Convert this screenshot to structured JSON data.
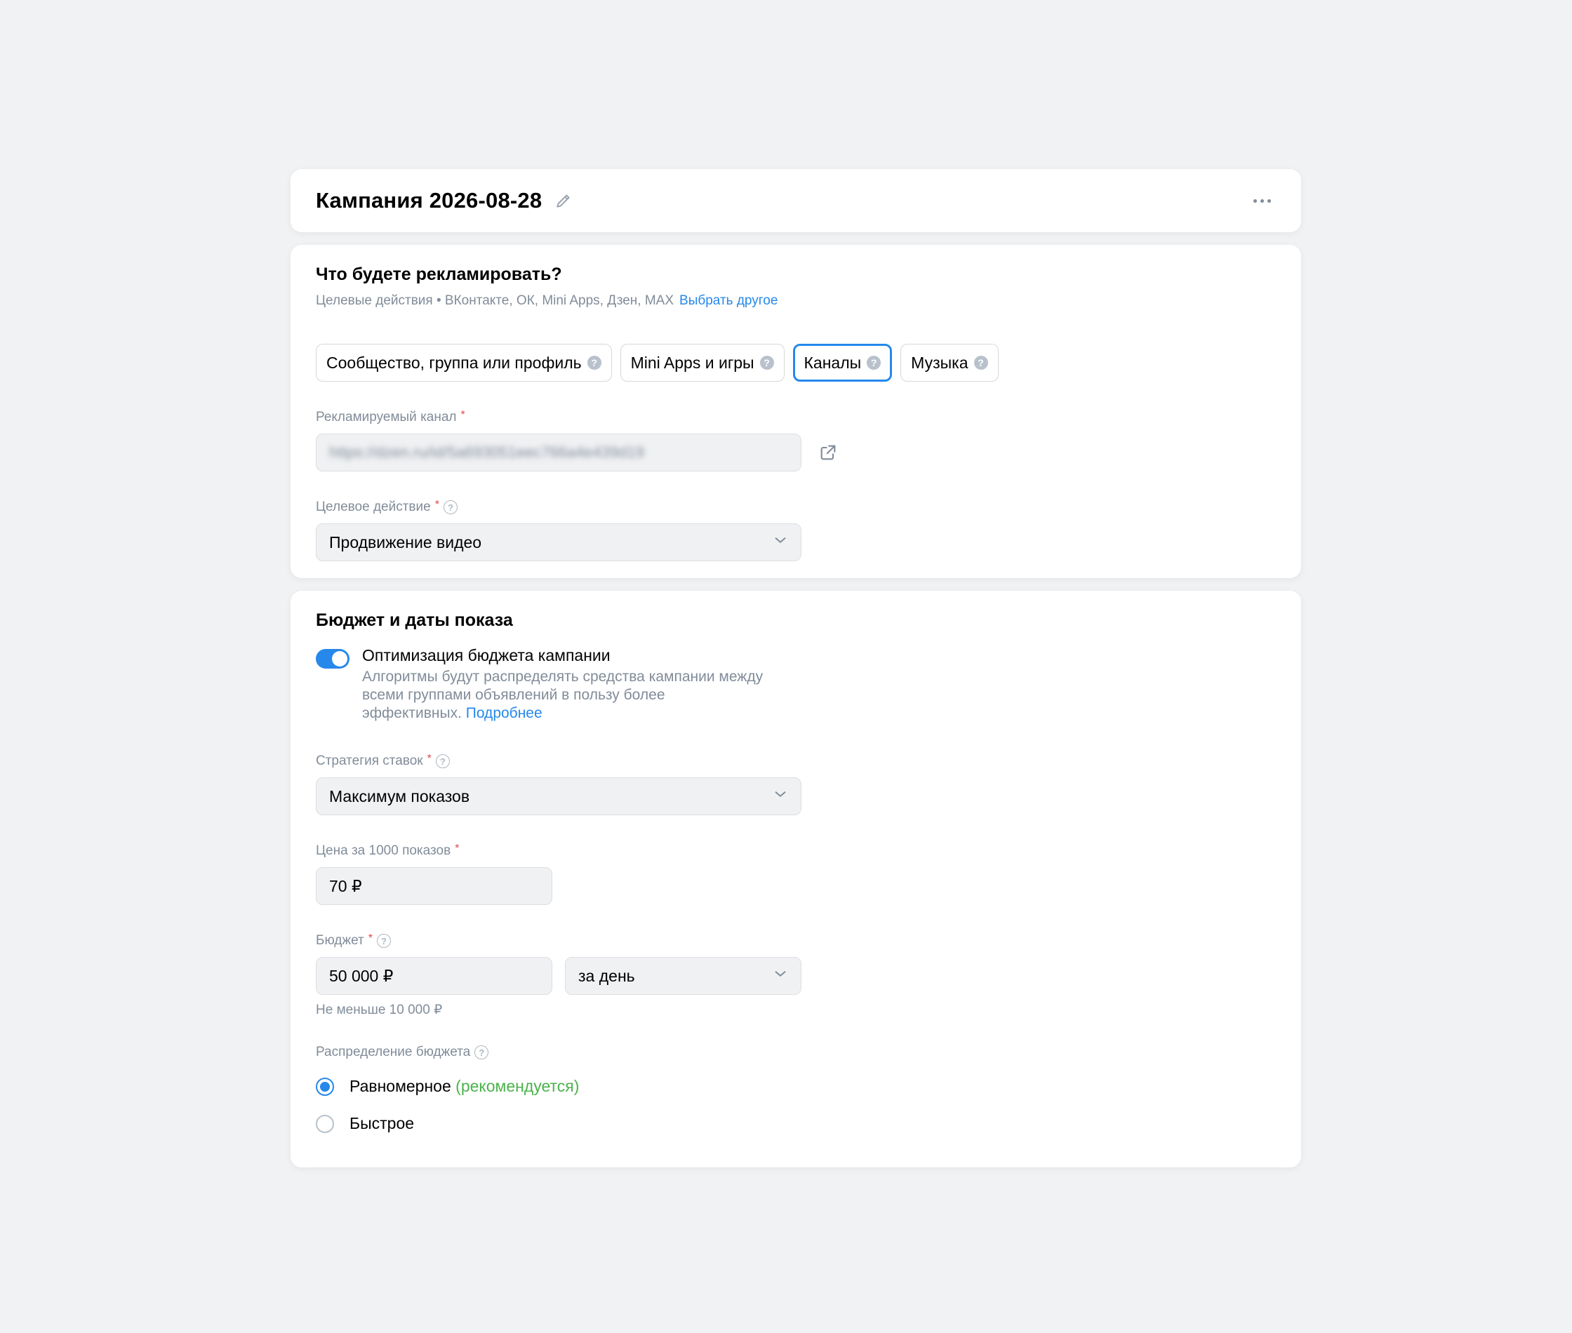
{
  "header": {
    "title": "Кампания 2026-08-28",
    "edit_icon": "pencil-icon",
    "more_icon": "more-horizontal-icon"
  },
  "promo": {
    "title": "Что будете рекламировать?",
    "subtitle": "Целевые действия • ВКонтакте, ОК, Mini Apps, Дзен, MAX",
    "subtitle_link": "Выбрать другое",
    "chips": [
      {
        "label": "Сообщество, группа или профиль",
        "active": false
      },
      {
        "label": "Mini Apps и игры",
        "active": false
      },
      {
        "label": "Каналы",
        "active": true
      },
      {
        "label": "Музыка",
        "active": false
      }
    ],
    "channel_label": "Рекламируемый канал",
    "channel_value": "https://dzen.ru/id/5a693051eec766a4e439d19",
    "external_link_icon": "external-link-icon",
    "action_label": "Целевое действие",
    "action_value": "Продвижение видео"
  },
  "budget": {
    "title": "Бюджет и даты показа",
    "optimization_title": "Оптимизация бюджета кампании",
    "optimization_enabled": true,
    "optimization_desc_1": "Алгоритмы будут распределять средства кампании между",
    "optimization_desc_2": "всеми группами объявлений в пользу более",
    "optimization_desc_3": "эффективных.",
    "optimization_link": "Подробнее",
    "strategy_label": "Стратегия ставок",
    "strategy_value": "Максимум показов",
    "price_label": "Цена за 1000 показов",
    "price_value": "70 ₽",
    "budget_label": "Бюджет",
    "budget_value": "50 000 ₽",
    "period_value": "за день",
    "budget_hint": "Не меньше 10 000 ₽",
    "distribution_label": "Распределение бюджета",
    "options": [
      {
        "label": "Равномерное",
        "note": "(рекомендуется)",
        "selected": true
      },
      {
        "label": "Быстрое",
        "note": "",
        "selected": false
      }
    ]
  },
  "colors": {
    "accent": "#2688eb",
    "recommended": "#4bb34b",
    "required": "#e64646",
    "secondary_text": "#818c99",
    "background": "#f1f2f4"
  }
}
